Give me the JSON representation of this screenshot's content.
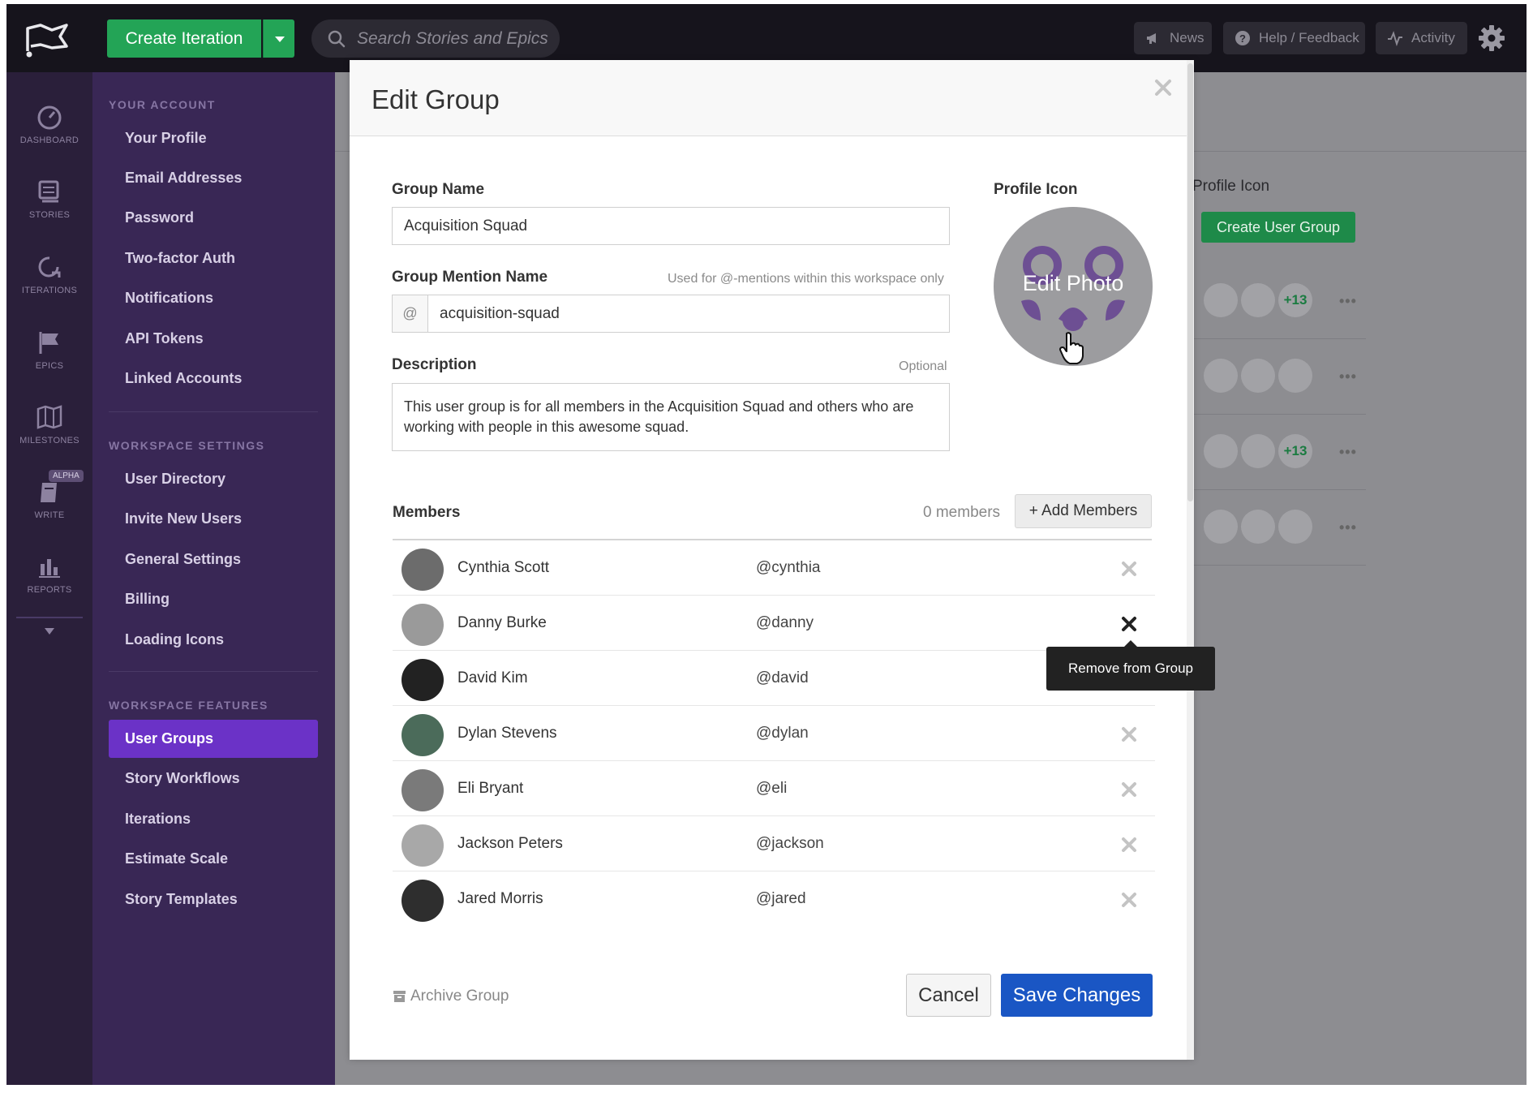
{
  "topbar": {
    "create_label": "Create Iteration",
    "search_placeholder": "Search Stories and Epics",
    "news": "News",
    "help": "Help / Feedback",
    "activity": "Activity"
  },
  "rail": {
    "dashboard": "DASHBOARD",
    "stories": "STORIES",
    "iterations": "ITERATIONS",
    "epics": "EPICS",
    "milestones": "MILESTONES",
    "write": "WRITE",
    "alpha": "ALPHA",
    "reports": "REPORTS"
  },
  "nav": {
    "your_account": "YOUR ACCOUNT",
    "account_items": [
      "Your Profile",
      "Email Addresses",
      "Password",
      "Two-factor Auth",
      "Notifications",
      "API Tokens",
      "Linked Accounts"
    ],
    "workspace_settings": "WORKSPACE SETTINGS",
    "settings_items": [
      "User Directory",
      "Invite New Users",
      "General Settings",
      "Billing",
      "Loading Icons"
    ],
    "workspace_features": "WORKSPACE FEATURES",
    "features_items": [
      "User Groups",
      "Story Workflows",
      "Iterations",
      "Estimate Scale",
      "Story Templates"
    ]
  },
  "background": {
    "profile_icon": "Profile Icon",
    "create_user_group": "Create User Group",
    "more_count": "+13",
    "dots": "•••"
  },
  "modal": {
    "title": "Edit Group",
    "group_name_label": "Group Name",
    "group_name_value": "Acquisition Squad",
    "mention_label": "Group Mention Name",
    "mention_hint": "Used for @-mentions within this workspace only",
    "mention_prefix": "@",
    "mention_value": "acquisition-squad",
    "description_label": "Description",
    "description_hint": "Optional",
    "description_value": "This user group is for all members in the Acquisition Squad and others who are working with people in this awesome squad.",
    "profile_icon_label": "Profile Icon",
    "edit_photo": "Edit Photo",
    "members_label": "Members",
    "members_count": "0 members",
    "add_members": "+ Add Members",
    "tooltip": "Remove from Group",
    "archive": "Archive Group",
    "cancel": "Cancel",
    "save": "Save Changes"
  },
  "members": [
    {
      "name": "Cynthia Scott",
      "handle": "@cynthia"
    },
    {
      "name": "Danny Burke",
      "handle": "@danny"
    },
    {
      "name": "David Kim",
      "handle": "@david"
    },
    {
      "name": "Dylan Stevens",
      "handle": "@dylan"
    },
    {
      "name": "Eli Bryant",
      "handle": "@eli"
    },
    {
      "name": "Jackson Peters",
      "handle": "@jackson"
    },
    {
      "name": "Jared Morris",
      "handle": "@jared"
    }
  ],
  "colors": {
    "brand_green": "#23a456",
    "nav_purple": "#392755",
    "active_purple": "#6b32c7",
    "primary_blue": "#1a56c4"
  }
}
